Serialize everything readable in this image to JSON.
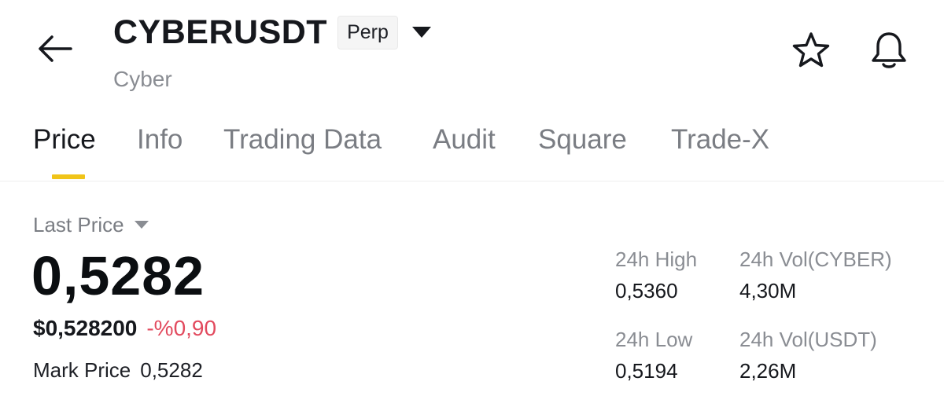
{
  "header": {
    "symbol": "CYBERUSDT",
    "badge": "Perp",
    "subtitle": "Cyber",
    "icons": {
      "back": "arrow-left-icon",
      "dropdown": "caret-down-icon",
      "favorite": "star-icon",
      "alert": "bell-icon"
    }
  },
  "tabs": [
    {
      "label": "Price",
      "active": true
    },
    {
      "label": "Info",
      "active": false
    },
    {
      "label": "Trading Data",
      "active": false
    },
    {
      "label": "Audit",
      "active": false
    },
    {
      "label": "Square",
      "active": false
    },
    {
      "label": "Trade-X",
      "active": false
    }
  ],
  "price": {
    "label": "Last Price",
    "value": "0,5282",
    "fiat_value": "$0,528200",
    "change": "-%0,90",
    "mark_label": "Mark Price",
    "mark_value": "0,5282"
  },
  "stats": {
    "high_label": "24h High",
    "high_value": "0,5360",
    "vol_base_label": "24h Vol(CYBER)",
    "vol_base_value": "4,30M",
    "low_label": "24h Low",
    "low_value": "0,5194",
    "vol_quote_label": "24h Vol(USDT)",
    "vol_quote_value": "2,26M"
  },
  "colors": {
    "accent": "#f0c419",
    "negative": "#e24a5e",
    "text_primary": "#16181d",
    "text_secondary": "#8a8d93"
  }
}
